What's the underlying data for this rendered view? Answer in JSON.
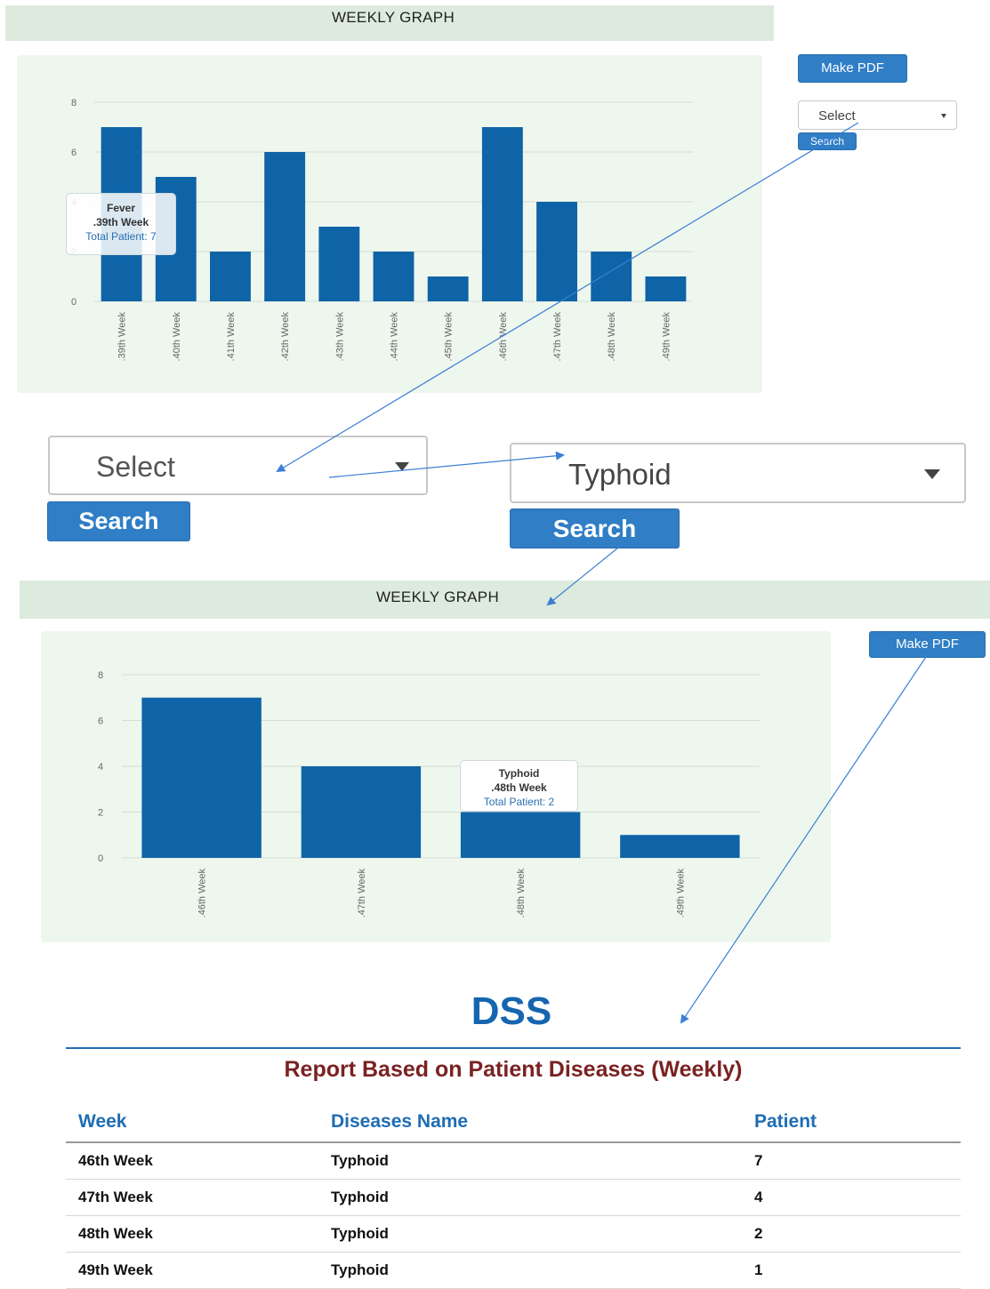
{
  "top": {
    "header_title": "WEEKLY GRAPH",
    "make_pdf_label": "Make PDF",
    "select_value": "Select",
    "search_label": "Search",
    "tooltip": {
      "name": "Fever",
      "week": ".39th Week",
      "value_text": "Total Patient: 7"
    }
  },
  "zoom_left": {
    "select_value": "Select",
    "search_label": "Search"
  },
  "zoom_right": {
    "select_value": "Typhoid",
    "search_label": "Search"
  },
  "bottom": {
    "header_title": "WEEKLY GRAPH",
    "make_pdf_label": "Make PDF",
    "tooltip": {
      "name": "Typhoid",
      "week": ".48th Week",
      "value_text": "Total Patient: 2"
    }
  },
  "report": {
    "brand": "DSS",
    "title": "Report Based on Patient Diseases (Weekly)",
    "columns": [
      "Week",
      "Diseases Name",
      "Patient"
    ],
    "rows": [
      [
        "46th Week",
        "Typhoid",
        "7"
      ],
      [
        "47th Week",
        "Typhoid",
        "4"
      ],
      [
        "48th Week",
        "Typhoid",
        "2"
      ],
      [
        "49th Week",
        "Typhoid",
        "1"
      ]
    ]
  },
  "colors": {
    "bar": "#0f64a8",
    "accent": "#2f7ec6",
    "header_bg": "#dcebdd",
    "panel_bg": "#eef7ee",
    "arrow": "#3b7fd4"
  },
  "chart_data": [
    {
      "type": "bar",
      "categories": [
        ".39th Week",
        ".40th Week",
        ".41th Week",
        ".42th Week",
        ".43th Week",
        ".44th Week",
        ".45th Week",
        ".46th Week",
        ".47th Week",
        ".48th Week",
        ".49th Week"
      ],
      "values": [
        7,
        5,
        2,
        6,
        3,
        2,
        1,
        7,
        4,
        2,
        1
      ],
      "yticks": [
        0,
        2,
        4,
        6,
        8
      ],
      "ylim": [
        0,
        8
      ],
      "grid": true
    },
    {
      "type": "bar",
      "categories": [
        ".46th Week",
        ".47th Week",
        ".48th Week",
        ".49th Week"
      ],
      "values": [
        7,
        4,
        2,
        1
      ],
      "yticks": [
        0,
        2,
        4,
        6,
        8
      ],
      "ylim": [
        0,
        8
      ],
      "grid": true
    }
  ]
}
